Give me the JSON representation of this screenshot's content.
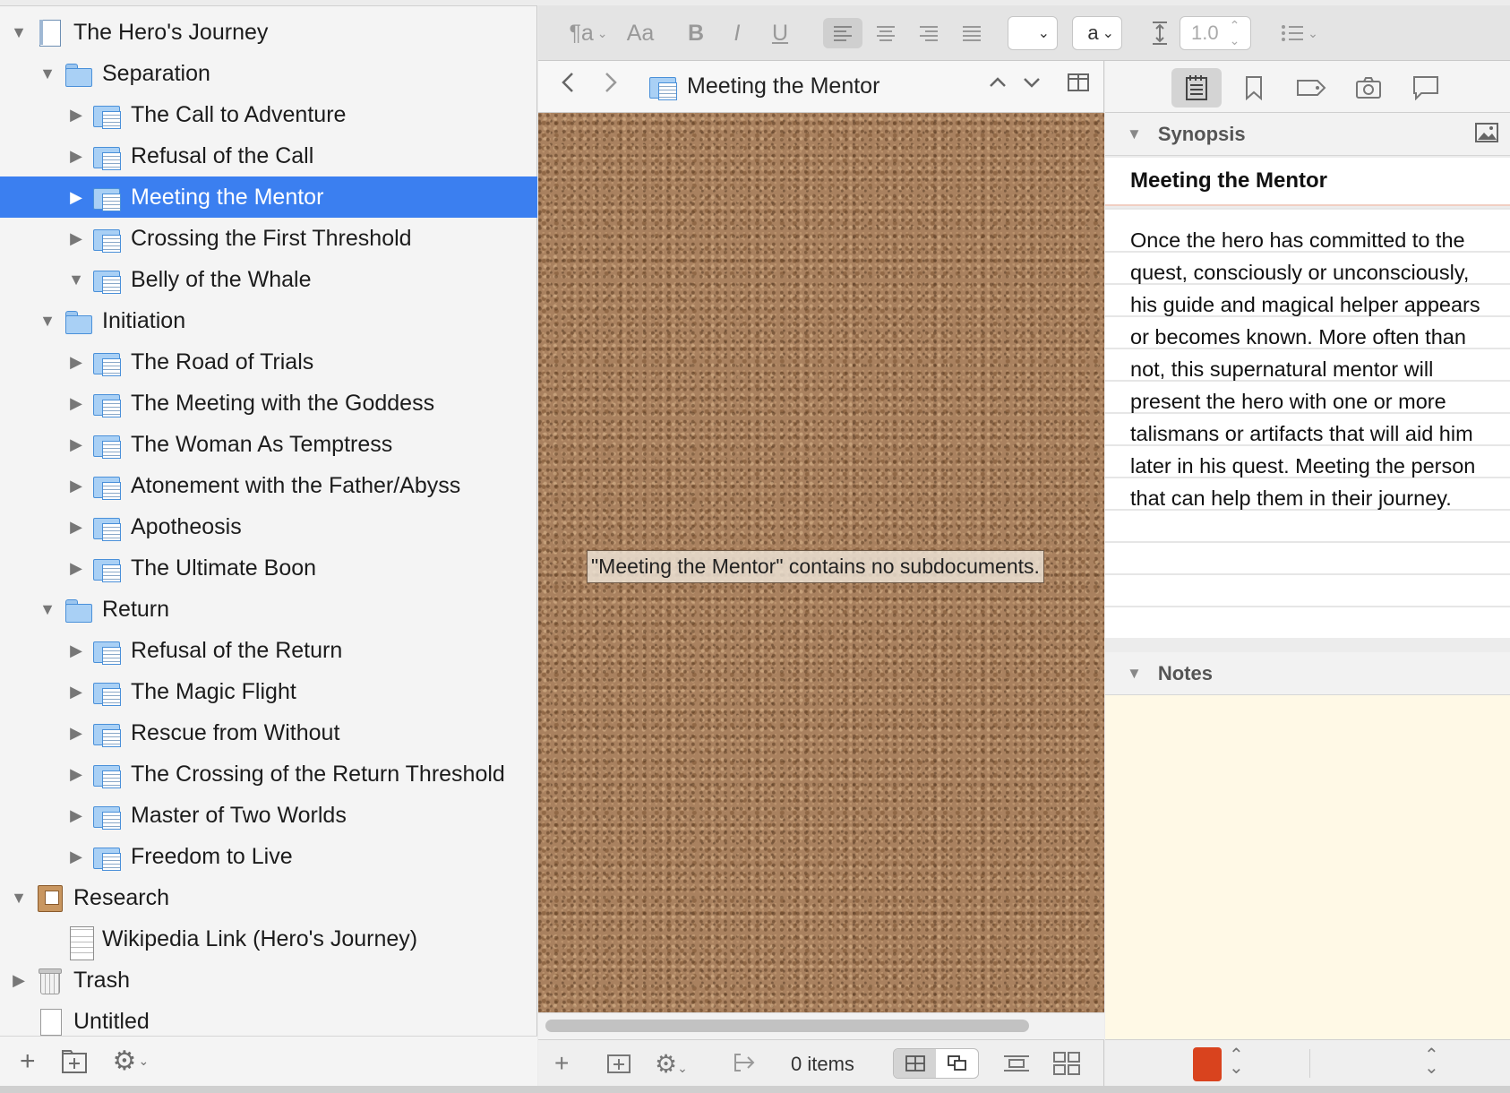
{
  "binder": {
    "items": [
      {
        "label": "The Hero's Journey",
        "level": 0,
        "icon": "project-doc-icon",
        "expanded": true
      },
      {
        "label": "Separation",
        "level": 1,
        "icon": "folder-icon",
        "expanded": true
      },
      {
        "label": "The Call to Adventure",
        "level": 2,
        "icon": "folder-doc-icon",
        "expanded": false
      },
      {
        "label": "Refusal of the Call",
        "level": 2,
        "icon": "folder-doc-icon",
        "expanded": false
      },
      {
        "label": "Meeting the Mentor",
        "level": 2,
        "icon": "folder-doc-icon",
        "expanded": false,
        "selected": true
      },
      {
        "label": "Crossing the First Threshold",
        "level": 2,
        "icon": "folder-doc-icon",
        "expanded": false
      },
      {
        "label": "Belly of the Whale",
        "level": 2,
        "icon": "folder-doc-icon",
        "expanded": true
      },
      {
        "label": "Initiation",
        "level": 1,
        "icon": "folder-icon",
        "expanded": true
      },
      {
        "label": "The Road of Trials",
        "level": 2,
        "icon": "folder-doc-icon",
        "expanded": false
      },
      {
        "label": "The Meeting with the Goddess",
        "level": 2,
        "icon": "folder-doc-icon",
        "expanded": false
      },
      {
        "label": "The Woman As Temptress",
        "level": 2,
        "icon": "folder-doc-icon",
        "expanded": false
      },
      {
        "label": "Atonement with the Father/Abyss",
        "level": 2,
        "icon": "folder-doc-icon",
        "expanded": false
      },
      {
        "label": "Apotheosis",
        "level": 2,
        "icon": "folder-doc-icon",
        "expanded": false
      },
      {
        "label": "The Ultimate Boon",
        "level": 2,
        "icon": "folder-doc-icon",
        "expanded": false
      },
      {
        "label": "Return",
        "level": 1,
        "icon": "folder-icon",
        "expanded": true
      },
      {
        "label": "Refusal of the Return",
        "level": 2,
        "icon": "folder-doc-icon",
        "expanded": false
      },
      {
        "label": "The Magic Flight",
        "level": 2,
        "icon": "folder-doc-icon",
        "expanded": false
      },
      {
        "label": "Rescue from Without",
        "level": 2,
        "icon": "folder-doc-icon",
        "expanded": false
      },
      {
        "label": "The Crossing of the Return Threshold",
        "level": 2,
        "icon": "folder-doc-icon",
        "expanded": false
      },
      {
        "label": "Master of Two Worlds",
        "level": 2,
        "icon": "folder-doc-icon",
        "expanded": false
      },
      {
        "label": "Freedom to Live",
        "level": 2,
        "icon": "folder-doc-icon",
        "expanded": false
      },
      {
        "label": "Research",
        "level": 0,
        "icon": "research-folder-icon",
        "expanded": true
      },
      {
        "label": "Wikipedia Link (Hero's Journey)",
        "level": 1,
        "icon": "document-icon",
        "leaf": true
      },
      {
        "label": "Trash",
        "level": 0,
        "icon": "trash-icon",
        "expanded": false
      },
      {
        "label": "Untitled",
        "level": 0,
        "icon": "blank-doc-icon",
        "leaf": true
      }
    ]
  },
  "format_bar": {
    "line_spacing": "1.0",
    "font_variant": "a"
  },
  "editor": {
    "title": "Meeting the Mentor",
    "corkboard_message": "\"Meeting the Mentor\" contains no subdocuments.",
    "items_count": "0 items"
  },
  "inspector": {
    "synopsis_header": "Synopsis",
    "synopsis_title": "Meeting the Mentor",
    "synopsis_text": "Once the hero has committed to the quest, consciously or unconsciously, his guide and magical helper appears or becomes known. More often than not, this supernatural mentor will present the hero with one or more talismans or artifacts that will aid him later in his quest. Meeting the person that can help them in their journey.",
    "notes_header": "Notes",
    "label_color": "#d9431e"
  },
  "colors": {
    "selection": "#3b7ff0",
    "notes_background": "#fff9e6"
  }
}
